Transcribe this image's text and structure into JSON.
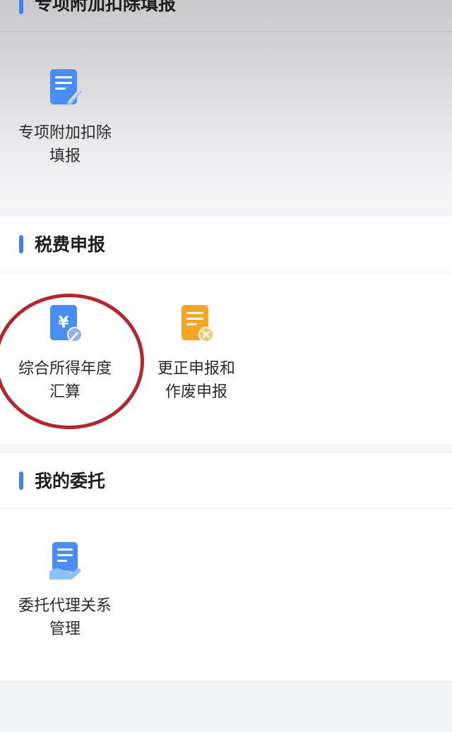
{
  "sections": [
    {
      "title": "专项附加扣除填报",
      "items": [
        {
          "label": "专项附加扣除\n填报",
          "icon": "document-edit-icon"
        }
      ]
    },
    {
      "title": "税费申报",
      "items": [
        {
          "label": "综合所得年度\n汇算",
          "icon": "yuan-document-icon"
        },
        {
          "label": "更正申报和\n作废申报",
          "icon": "document-cancel-icon"
        }
      ]
    },
    {
      "title": "我的委托",
      "items": [
        {
          "label": "委托代理关系\n管理",
          "icon": "document-hand-icon"
        }
      ]
    }
  ],
  "colors": {
    "accent": "#3f7fef",
    "icon_blue": "#4a8df5",
    "icon_orange": "#f5a623",
    "annotation_red": "#b5252c"
  }
}
